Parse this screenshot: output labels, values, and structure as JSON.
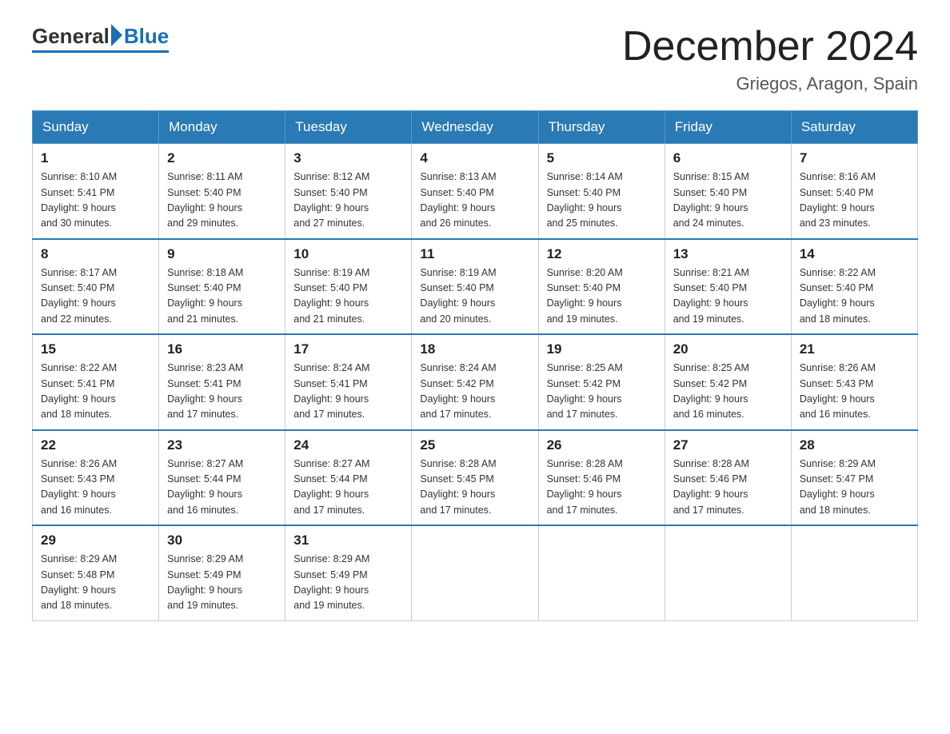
{
  "header": {
    "logo": {
      "general": "General",
      "blue": "Blue"
    },
    "title": "December 2024",
    "location": "Griegos, Aragon, Spain"
  },
  "weekdays": [
    "Sunday",
    "Monday",
    "Tuesday",
    "Wednesday",
    "Thursday",
    "Friday",
    "Saturday"
  ],
  "weeks": [
    [
      {
        "day": "1",
        "sunrise": "8:10 AM",
        "sunset": "5:41 PM",
        "daylight": "9 hours and 30 minutes."
      },
      {
        "day": "2",
        "sunrise": "8:11 AM",
        "sunset": "5:40 PM",
        "daylight": "9 hours and 29 minutes."
      },
      {
        "day": "3",
        "sunrise": "8:12 AM",
        "sunset": "5:40 PM",
        "daylight": "9 hours and 27 minutes."
      },
      {
        "day": "4",
        "sunrise": "8:13 AM",
        "sunset": "5:40 PM",
        "daylight": "9 hours and 26 minutes."
      },
      {
        "day": "5",
        "sunrise": "8:14 AM",
        "sunset": "5:40 PM",
        "daylight": "9 hours and 25 minutes."
      },
      {
        "day": "6",
        "sunrise": "8:15 AM",
        "sunset": "5:40 PM",
        "daylight": "9 hours and 24 minutes."
      },
      {
        "day": "7",
        "sunrise": "8:16 AM",
        "sunset": "5:40 PM",
        "daylight": "9 hours and 23 minutes."
      }
    ],
    [
      {
        "day": "8",
        "sunrise": "8:17 AM",
        "sunset": "5:40 PM",
        "daylight": "9 hours and 22 minutes."
      },
      {
        "day": "9",
        "sunrise": "8:18 AM",
        "sunset": "5:40 PM",
        "daylight": "9 hours and 21 minutes."
      },
      {
        "day": "10",
        "sunrise": "8:19 AM",
        "sunset": "5:40 PM",
        "daylight": "9 hours and 21 minutes."
      },
      {
        "day": "11",
        "sunrise": "8:19 AM",
        "sunset": "5:40 PM",
        "daylight": "9 hours and 20 minutes."
      },
      {
        "day": "12",
        "sunrise": "8:20 AM",
        "sunset": "5:40 PM",
        "daylight": "9 hours and 19 minutes."
      },
      {
        "day": "13",
        "sunrise": "8:21 AM",
        "sunset": "5:40 PM",
        "daylight": "9 hours and 19 minutes."
      },
      {
        "day": "14",
        "sunrise": "8:22 AM",
        "sunset": "5:40 PM",
        "daylight": "9 hours and 18 minutes."
      }
    ],
    [
      {
        "day": "15",
        "sunrise": "8:22 AM",
        "sunset": "5:41 PM",
        "daylight": "9 hours and 18 minutes."
      },
      {
        "day": "16",
        "sunrise": "8:23 AM",
        "sunset": "5:41 PM",
        "daylight": "9 hours and 17 minutes."
      },
      {
        "day": "17",
        "sunrise": "8:24 AM",
        "sunset": "5:41 PM",
        "daylight": "9 hours and 17 minutes."
      },
      {
        "day": "18",
        "sunrise": "8:24 AM",
        "sunset": "5:42 PM",
        "daylight": "9 hours and 17 minutes."
      },
      {
        "day": "19",
        "sunrise": "8:25 AM",
        "sunset": "5:42 PM",
        "daylight": "9 hours and 17 minutes."
      },
      {
        "day": "20",
        "sunrise": "8:25 AM",
        "sunset": "5:42 PM",
        "daylight": "9 hours and 16 minutes."
      },
      {
        "day": "21",
        "sunrise": "8:26 AM",
        "sunset": "5:43 PM",
        "daylight": "9 hours and 16 minutes."
      }
    ],
    [
      {
        "day": "22",
        "sunrise": "8:26 AM",
        "sunset": "5:43 PM",
        "daylight": "9 hours and 16 minutes."
      },
      {
        "day": "23",
        "sunrise": "8:27 AM",
        "sunset": "5:44 PM",
        "daylight": "9 hours and 16 minutes."
      },
      {
        "day": "24",
        "sunrise": "8:27 AM",
        "sunset": "5:44 PM",
        "daylight": "9 hours and 17 minutes."
      },
      {
        "day": "25",
        "sunrise": "8:28 AM",
        "sunset": "5:45 PM",
        "daylight": "9 hours and 17 minutes."
      },
      {
        "day": "26",
        "sunrise": "8:28 AM",
        "sunset": "5:46 PM",
        "daylight": "9 hours and 17 minutes."
      },
      {
        "day": "27",
        "sunrise": "8:28 AM",
        "sunset": "5:46 PM",
        "daylight": "9 hours and 17 minutes."
      },
      {
        "day": "28",
        "sunrise": "8:29 AM",
        "sunset": "5:47 PM",
        "daylight": "9 hours and 18 minutes."
      }
    ],
    [
      {
        "day": "29",
        "sunrise": "8:29 AM",
        "sunset": "5:48 PM",
        "daylight": "9 hours and 18 minutes."
      },
      {
        "day": "30",
        "sunrise": "8:29 AM",
        "sunset": "5:49 PM",
        "daylight": "9 hours and 19 minutes."
      },
      {
        "day": "31",
        "sunrise": "8:29 AM",
        "sunset": "5:49 PM",
        "daylight": "9 hours and 19 minutes."
      },
      null,
      null,
      null,
      null
    ]
  ]
}
